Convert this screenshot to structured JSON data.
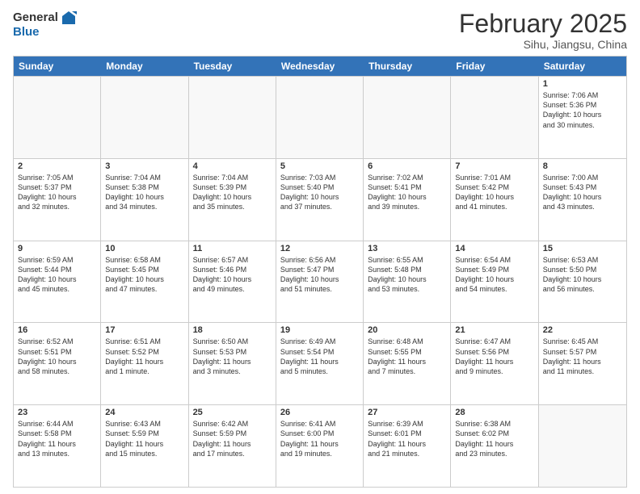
{
  "header": {
    "logo_line1": "General",
    "logo_line2": "Blue",
    "title": "February 2025",
    "subtitle": "Sihu, Jiangsu, China"
  },
  "weekdays": [
    "Sunday",
    "Monday",
    "Tuesday",
    "Wednesday",
    "Thursday",
    "Friday",
    "Saturday"
  ],
  "rows": [
    [
      {
        "day": "",
        "text": ""
      },
      {
        "day": "",
        "text": ""
      },
      {
        "day": "",
        "text": ""
      },
      {
        "day": "",
        "text": ""
      },
      {
        "day": "",
        "text": ""
      },
      {
        "day": "",
        "text": ""
      },
      {
        "day": "1",
        "text": "Sunrise: 7:06 AM\nSunset: 5:36 PM\nDaylight: 10 hours\nand 30 minutes."
      }
    ],
    [
      {
        "day": "2",
        "text": "Sunrise: 7:05 AM\nSunset: 5:37 PM\nDaylight: 10 hours\nand 32 minutes."
      },
      {
        "day": "3",
        "text": "Sunrise: 7:04 AM\nSunset: 5:38 PM\nDaylight: 10 hours\nand 34 minutes."
      },
      {
        "day": "4",
        "text": "Sunrise: 7:04 AM\nSunset: 5:39 PM\nDaylight: 10 hours\nand 35 minutes."
      },
      {
        "day": "5",
        "text": "Sunrise: 7:03 AM\nSunset: 5:40 PM\nDaylight: 10 hours\nand 37 minutes."
      },
      {
        "day": "6",
        "text": "Sunrise: 7:02 AM\nSunset: 5:41 PM\nDaylight: 10 hours\nand 39 minutes."
      },
      {
        "day": "7",
        "text": "Sunrise: 7:01 AM\nSunset: 5:42 PM\nDaylight: 10 hours\nand 41 minutes."
      },
      {
        "day": "8",
        "text": "Sunrise: 7:00 AM\nSunset: 5:43 PM\nDaylight: 10 hours\nand 43 minutes."
      }
    ],
    [
      {
        "day": "9",
        "text": "Sunrise: 6:59 AM\nSunset: 5:44 PM\nDaylight: 10 hours\nand 45 minutes."
      },
      {
        "day": "10",
        "text": "Sunrise: 6:58 AM\nSunset: 5:45 PM\nDaylight: 10 hours\nand 47 minutes."
      },
      {
        "day": "11",
        "text": "Sunrise: 6:57 AM\nSunset: 5:46 PM\nDaylight: 10 hours\nand 49 minutes."
      },
      {
        "day": "12",
        "text": "Sunrise: 6:56 AM\nSunset: 5:47 PM\nDaylight: 10 hours\nand 51 minutes."
      },
      {
        "day": "13",
        "text": "Sunrise: 6:55 AM\nSunset: 5:48 PM\nDaylight: 10 hours\nand 53 minutes."
      },
      {
        "day": "14",
        "text": "Sunrise: 6:54 AM\nSunset: 5:49 PM\nDaylight: 10 hours\nand 54 minutes."
      },
      {
        "day": "15",
        "text": "Sunrise: 6:53 AM\nSunset: 5:50 PM\nDaylight: 10 hours\nand 56 minutes."
      }
    ],
    [
      {
        "day": "16",
        "text": "Sunrise: 6:52 AM\nSunset: 5:51 PM\nDaylight: 10 hours\nand 58 minutes."
      },
      {
        "day": "17",
        "text": "Sunrise: 6:51 AM\nSunset: 5:52 PM\nDaylight: 11 hours\nand 1 minute."
      },
      {
        "day": "18",
        "text": "Sunrise: 6:50 AM\nSunset: 5:53 PM\nDaylight: 11 hours\nand 3 minutes."
      },
      {
        "day": "19",
        "text": "Sunrise: 6:49 AM\nSunset: 5:54 PM\nDaylight: 11 hours\nand 5 minutes."
      },
      {
        "day": "20",
        "text": "Sunrise: 6:48 AM\nSunset: 5:55 PM\nDaylight: 11 hours\nand 7 minutes."
      },
      {
        "day": "21",
        "text": "Sunrise: 6:47 AM\nSunset: 5:56 PM\nDaylight: 11 hours\nand 9 minutes."
      },
      {
        "day": "22",
        "text": "Sunrise: 6:45 AM\nSunset: 5:57 PM\nDaylight: 11 hours\nand 11 minutes."
      }
    ],
    [
      {
        "day": "23",
        "text": "Sunrise: 6:44 AM\nSunset: 5:58 PM\nDaylight: 11 hours\nand 13 minutes."
      },
      {
        "day": "24",
        "text": "Sunrise: 6:43 AM\nSunset: 5:59 PM\nDaylight: 11 hours\nand 15 minutes."
      },
      {
        "day": "25",
        "text": "Sunrise: 6:42 AM\nSunset: 5:59 PM\nDaylight: 11 hours\nand 17 minutes."
      },
      {
        "day": "26",
        "text": "Sunrise: 6:41 AM\nSunset: 6:00 PM\nDaylight: 11 hours\nand 19 minutes."
      },
      {
        "day": "27",
        "text": "Sunrise: 6:39 AM\nSunset: 6:01 PM\nDaylight: 11 hours\nand 21 minutes."
      },
      {
        "day": "28",
        "text": "Sunrise: 6:38 AM\nSunset: 6:02 PM\nDaylight: 11 hours\nand 23 minutes."
      },
      {
        "day": "",
        "text": ""
      }
    ]
  ]
}
